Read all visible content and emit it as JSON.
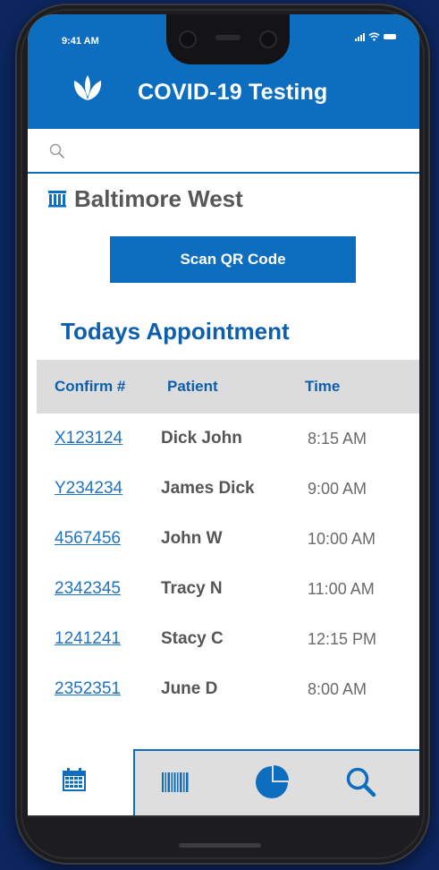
{
  "status_bar": {
    "time": "9:41 AM"
  },
  "app": {
    "title": "COVID-19 Testing",
    "brand_color": "#0d6ec0"
  },
  "search": {
    "placeholder": "",
    "value": ""
  },
  "location": {
    "icon": "building-icon",
    "name": "Baltimore West"
  },
  "scan_button": {
    "label": "Scan QR Code"
  },
  "appointments": {
    "title": "Todays Appointment",
    "columns": [
      "Confirm #",
      "Patient",
      "Time"
    ],
    "rows": [
      {
        "confirm": "X123124",
        "patient": "Dick John",
        "time": "8:15 AM"
      },
      {
        "confirm": "Y234234",
        "patient": "James Dick",
        "time": "9:00 AM"
      },
      {
        "confirm": "4567456",
        "patient": "John W",
        "time": "10:00 AM"
      },
      {
        "confirm": "2342345",
        "patient": "Tracy N",
        "time": "11:00 AM"
      },
      {
        "confirm": "1241241",
        "patient": "Stacy C",
        "time": "12:15 PM"
      },
      {
        "confirm": "2352351",
        "patient": "June D",
        "time": "8:00 AM"
      }
    ]
  },
  "bottom_nav": {
    "items": [
      {
        "icon": "calendar-icon",
        "active": true
      },
      {
        "icon": "barcode-icon",
        "active": false
      },
      {
        "icon": "pie-chart-icon",
        "active": false
      },
      {
        "icon": "search-icon",
        "active": false
      }
    ]
  }
}
